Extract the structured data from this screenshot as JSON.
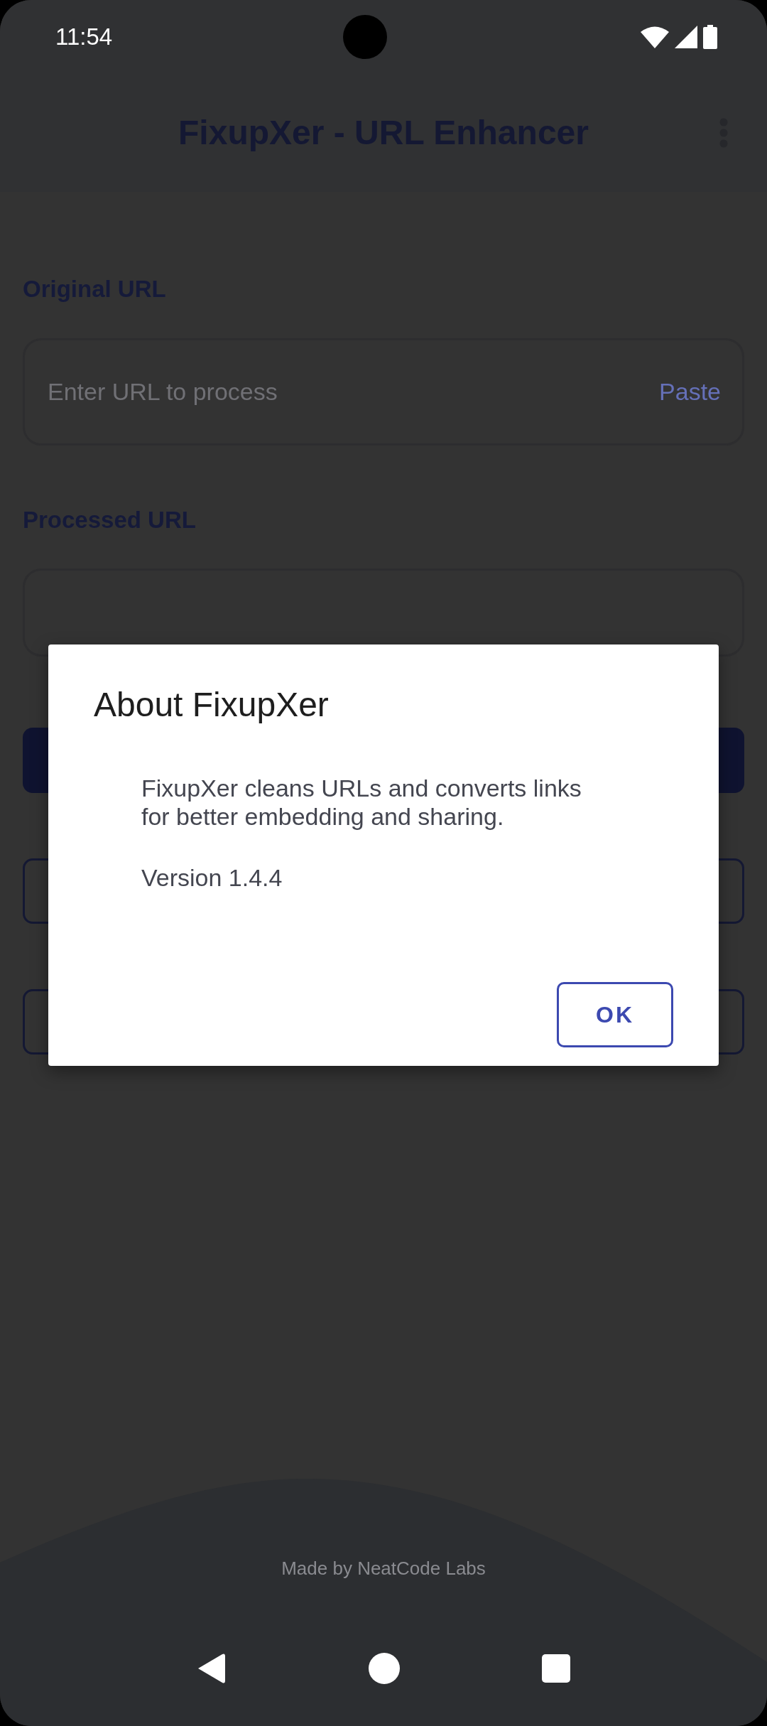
{
  "status_bar": {
    "time": "11:54"
  },
  "app_bar": {
    "title": "FixupXer - URL Enhancer"
  },
  "original_url": {
    "label": "Original URL",
    "placeholder": "Enter URL to process",
    "action": "Paste"
  },
  "processed_url": {
    "label": "Processed URL"
  },
  "action_buttons": [
    {
      "kind": "filled"
    },
    {
      "kind": "outlined"
    },
    {
      "kind": "outlined"
    }
  ],
  "dialog": {
    "title": "About FixupXer",
    "body": "FixupXer cleans URLs and converts links for better embedding and sharing.",
    "version": "Version 1.4.4",
    "button": "OK"
  },
  "footer": "Made by NeatCode Labs"
}
